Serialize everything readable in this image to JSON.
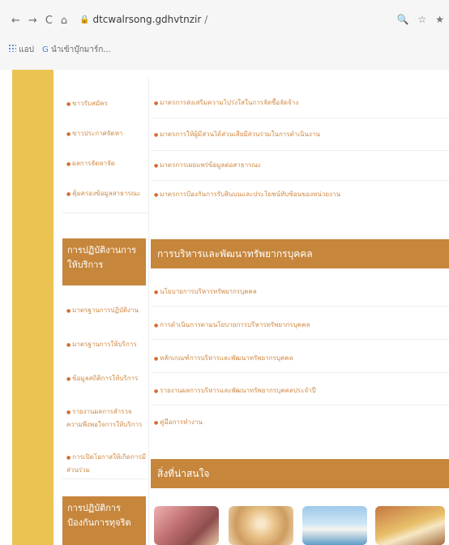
{
  "browser": {
    "nav_icons": [
      "←",
      "→",
      "C",
      "⌂"
    ],
    "lock_icon": "🔒",
    "url_host": "dtcwalrsong.gdhvtnzir",
    "url_path": "/",
    "tool_icons": [
      "🔍",
      "☆",
      "★"
    ],
    "bookmarks": [
      {
        "icon": "apps-icon",
        "label": "แอป"
      },
      {
        "icon": "google-icon",
        "label": "นำเข้าบุ๊กมาร์ก..."
      }
    ]
  },
  "sidebar": {
    "links_top": [
      "ขาวรับสมัคร",
      "ขาวประกาศจัดหา",
      "ผลการจัดหาจัด",
      "คุ้มครองข้อมูลสาธารณะ"
    ],
    "section1_title": "การปฏิบัติงานการให้บริการ",
    "links_mid": [
      "มาตรฐานการปฏิบัติงาน",
      "มาตรฐานการให้บริการ",
      "ข้อมูลสถิติการให้บริการ",
      "รายงานผลการสำรวจความพึงพอใจการให้บริการ",
      "การเปิดโอกาสให้เกิดการมีส่วนร่วม"
    ],
    "section2_title": "การปฏิบัติการป้องกันการทุจริต"
  },
  "main": {
    "links_top": [
      "มาตรการส่งเสริมความโปร่งใสในการจัดซื้อจัดจ้าง",
      "มาตรการให้ผู้มีส่วนได้ส่วนเสียมีส่วนร่วมในการดำเนินงาน",
      "มาตรการเผยแพร่ข้อมูลต่อสาธารณะ",
      "มาตรการป้องกันการรับสินบนและประโยชน์ทับซ้อนของหน่วยงาน"
    ],
    "section1_title": "การบริหารและพัฒนาทรัพยากรบุคคล",
    "links_mid": [
      "นโยบายการบริหารทรัพยากรบุคคล",
      "การดำเนินการตามนโยบายการบริหารทรัพยากรบุคคล",
      "หลักเกณฑ์การบริหารและพัฒนาทรัพยากรบุคคล",
      "รายงานผลการบริหารและพัฒนาทรัพยากรบุคคลประจำปี",
      "คู่มือการทำงาน"
    ],
    "section2_title": "สิ่งที่น่าสนใจ"
  },
  "colors": {
    "sidebar_strip": "#eac352",
    "section_header": "#c6863c",
    "link": "#cf8a46",
    "bullet": "#d66a2c"
  }
}
